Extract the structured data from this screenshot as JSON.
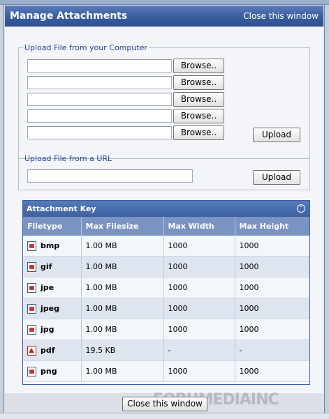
{
  "window": {
    "title": "Manage Attachments",
    "close_link": "Close this window"
  },
  "upload_computer": {
    "legend": "Upload File from your Computer",
    "browse_label": "Browse..",
    "upload_label": "Upload"
  },
  "upload_url": {
    "legend": "Upload File from a URL",
    "upload_label": "Upload"
  },
  "attachment_key": {
    "title": "Attachment Key",
    "collapse_icon": "collapse-icon",
    "columns": [
      "Filetype",
      "Max Filesize",
      "Max Width",
      "Max Height"
    ],
    "rows": [
      {
        "type": "bmp",
        "size": "1.00 MB",
        "width": "1000",
        "height": "1000",
        "icon": "image-file-icon"
      },
      {
        "type": "gif",
        "size": "1.00 MB",
        "width": "1000",
        "height": "1000",
        "icon": "image-file-icon"
      },
      {
        "type": "jpe",
        "size": "1.00 MB",
        "width": "1000",
        "height": "1000",
        "icon": "image-file-icon"
      },
      {
        "type": "jpeg",
        "size": "1.00 MB",
        "width": "1000",
        "height": "1000",
        "icon": "image-file-icon"
      },
      {
        "type": "jpg",
        "size": "1.00 MB",
        "width": "1000",
        "height": "1000",
        "icon": "image-file-icon"
      },
      {
        "type": "pdf",
        "size": "19.5 KB",
        "width": "-",
        "height": "-",
        "icon": "pdf-file-icon"
      },
      {
        "type": "png",
        "size": "1.00 MB",
        "width": "1000",
        "height": "1000",
        "icon": "image-file-icon"
      }
    ]
  },
  "bottom_close": "Close this window",
  "watermark": "FORUMEDIAINC",
  "colors": {
    "titlebar": "#3a5d9e",
    "header_row": "#7a93c2",
    "legend_text": "#22419a"
  }
}
